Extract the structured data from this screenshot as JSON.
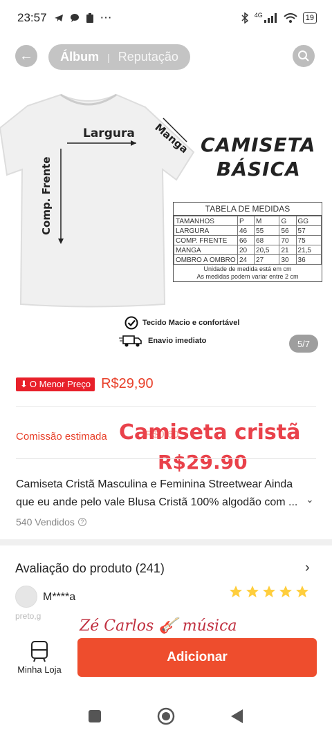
{
  "status_bar": {
    "time": "23:57",
    "network": "4G",
    "battery": "19"
  },
  "nav": {
    "tab_album": "Álbum",
    "tab_reputation": "Reputação"
  },
  "image": {
    "label_width": "Largura",
    "label_sleeve": "Manga",
    "label_front": "Comp. Frente",
    "title_line1": "CAMISETA",
    "title_line2": "BÁSICA",
    "table": {
      "heading": "TABELA DE MEDIDAS",
      "columns": [
        "TAMANHOS",
        "P",
        "M",
        "G",
        "GG"
      ],
      "rows": [
        [
          "LARGURA",
          "46",
          "55",
          "56",
          "57"
        ],
        [
          "COMP. FRENTE",
          "66",
          "68",
          "70",
          "75"
        ],
        [
          "MANGA",
          "20",
          "20,5",
          "21",
          "21,5"
        ],
        [
          "OMBRO A OMBRO",
          "24",
          "27",
          "30",
          "36"
        ]
      ],
      "note1": "Unidade de medida está em cm",
      "note2": "As medidas podem variar entre 2 cm"
    },
    "feature1": "Tecido Macio e confortável",
    "feature2": "Enavio imediato",
    "counter": "5/7"
  },
  "price": {
    "tag": "O Menor Preço",
    "value": "R$29,90"
  },
  "commission": {
    "label": "Comissão estimada",
    "value": "R$0,60"
  },
  "watermark": {
    "line1": "Camiseta cristã",
    "line2": "R$29.90",
    "signature": "Zé Carlos 🎸 música"
  },
  "product": {
    "description": "Camiseta Cristã Masculina e Feminina Streetwear Ainda que eu ande pelo vale Blusa Cristã 100% algodão com ...",
    "sold": "540 Vendidos"
  },
  "reviews": {
    "title": "Avaliação do produto (241)",
    "reviewer": "M****a",
    "variant": "preto,g",
    "rating": 5
  },
  "bottom": {
    "shop_label": "Minha Loja",
    "add_label": "Adicionar"
  },
  "colors": {
    "accent": "#ee4d2d",
    "price": "#e8402a",
    "star": "#ffce3d"
  }
}
